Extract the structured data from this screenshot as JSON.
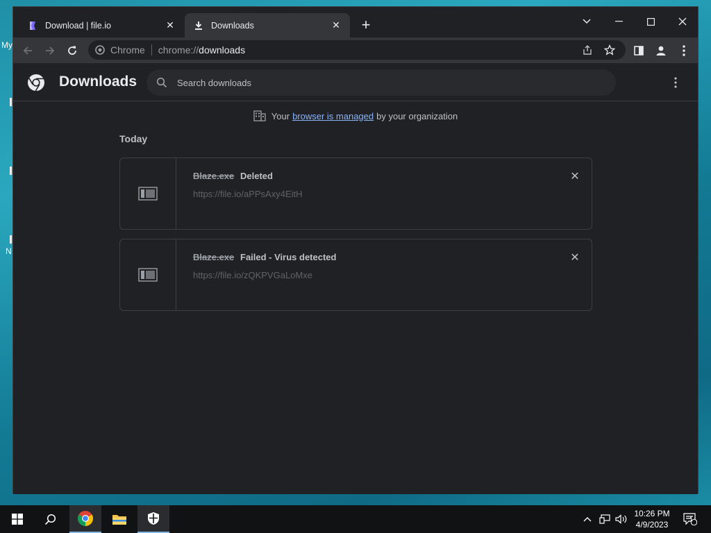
{
  "desktop": {
    "label_my": "My",
    "label_n": "N"
  },
  "tabs": [
    {
      "title": "Download | file.io",
      "active": false
    },
    {
      "title": "Downloads",
      "active": true
    }
  ],
  "omnibox": {
    "origin": "Chrome",
    "scheme": "chrome://",
    "host": "downloads"
  },
  "page": {
    "title": "Downloads",
    "search_placeholder": "Search downloads",
    "managed_prefix": "Your",
    "managed_link": "browser is managed",
    "managed_suffix": "by your organization",
    "section": "Today"
  },
  "downloads": [
    {
      "name": "Blaze.exe",
      "status": "Deleted",
      "url": "https://file.io/aPPsAxy4EitH"
    },
    {
      "name": "Blaze.exe",
      "status": "Failed - Virus detected",
      "url": "https://file.io/zQKPVGaLoMxe"
    }
  ],
  "taskbar": {
    "time": "10:26 PM",
    "date": "4/9/2023",
    "notification_count": "1"
  },
  "colors": {
    "link": "#8ab4f8",
    "page_bg": "#202124",
    "toolbar_bg": "#35363a"
  }
}
